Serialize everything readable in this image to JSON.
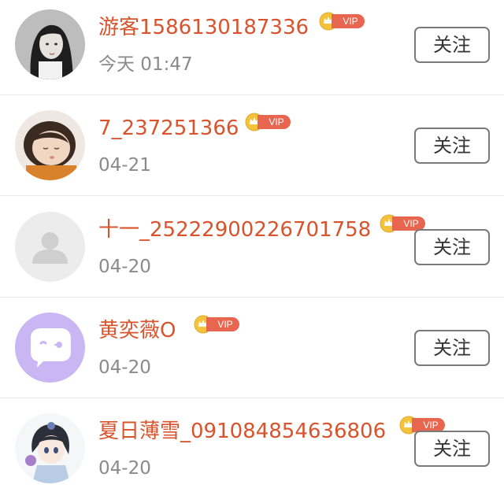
{
  "users": [
    {
      "name": "游客1586130187336",
      "time": "今天 01:47",
      "badge": "VIP",
      "button": "关注",
      "avatar": "girl-photo-avatar"
    },
    {
      "name": "7_237251366",
      "time": "04-21",
      "badge": "VIP",
      "button": "关注",
      "avatar": "baby-photo-avatar"
    },
    {
      "name": "十一_25222900226701758",
      "time": "04-20",
      "badge": "VIP",
      "button": "关注",
      "avatar": "default-user-avatar"
    },
    {
      "name": "黄奕薇O",
      "time": "04-20",
      "badge": "VIP",
      "button": "关注",
      "avatar": "chat-bubble-avatar"
    },
    {
      "name": "夏日薄雪_091084854636806",
      "time": "04-20",
      "badge": "VIP",
      "button": "关注",
      "avatar": "anime-girl-avatar"
    }
  ],
  "colors": {
    "name": "#d9532c",
    "time": "#8a8a8a",
    "vip_pill": "#e8654f",
    "crown": "#f5c33b",
    "button_border": "#7a7a7a"
  }
}
